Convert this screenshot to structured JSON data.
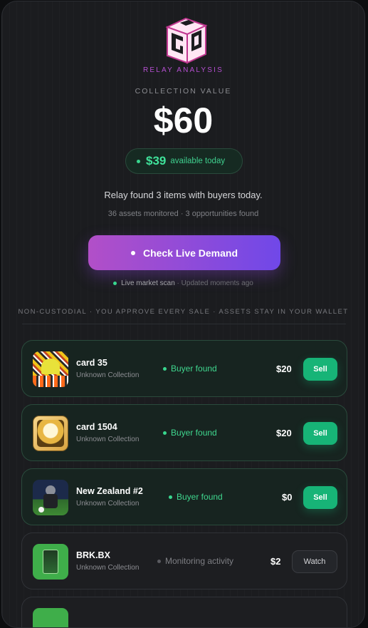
{
  "brand": {
    "name": "RELAY ANALYSIS"
  },
  "summary": {
    "collection_value_label": "COLLECTION VALUE",
    "collection_value": "$60",
    "available_amount": "$39",
    "available_text": "available today",
    "found_text": "Relay found 3 items with buyers today.",
    "stats_text": "36 assets monitored · 3 opportunities found"
  },
  "cta": {
    "label": "Check Live Demand"
  },
  "scan": {
    "live": "Live market scan",
    "updated": "· Updated moments ago"
  },
  "trust": {
    "text": "NON-CUSTODIAL · YOU APPROVE EVERY SALE · ASSETS STAY IN YOUR WALLET"
  },
  "items": [
    {
      "name": "card 35",
      "collection": "Unknown Collection",
      "status": "Buyer found",
      "price": "$20",
      "action": "Sell"
    },
    {
      "name": "card 1504",
      "collection": "Unknown Collection",
      "status": "Buyer found",
      "price": "$20",
      "action": "Sell"
    },
    {
      "name": "New Zealand #2",
      "collection": "Unknown Collection",
      "status": "Buyer found",
      "price": "$0",
      "action": "Sell"
    },
    {
      "name": "BRK.BX",
      "collection": "Unknown Collection",
      "status": "Monitoring activity",
      "price": "$2",
      "action": "Watch"
    }
  ],
  "colors": {
    "accent_purple": "#b24fc8",
    "accent_violet": "#7048e8",
    "success": "#17b477",
    "background": "#1b1c1f"
  }
}
